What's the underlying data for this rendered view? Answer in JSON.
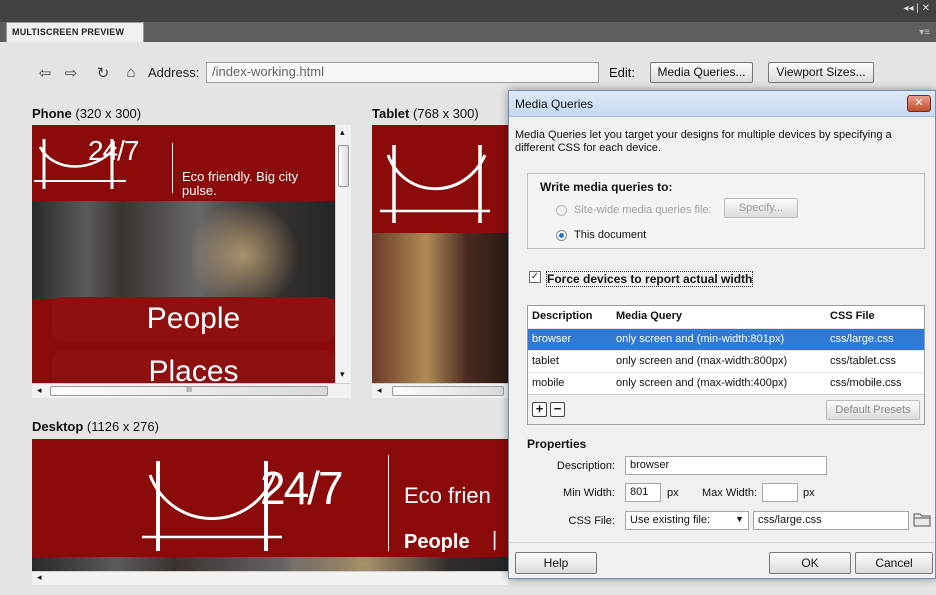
{
  "panel": {
    "tab_label": "MULTISCREEN PREVIEW",
    "window_controls": "◂◂ | ✕",
    "menu_icon": "▾≡"
  },
  "toolbar": {
    "back_icon": "back-icon",
    "forward_icon": "forward-icon",
    "refresh_icon": "refresh-icon",
    "home_icon": "home-icon",
    "address_label": "Address:",
    "address_value": "/index-working.html",
    "edit_label": "Edit:",
    "media_queries_button": "Media Queries...",
    "viewport_sizes_button": "Viewport Sizes..."
  },
  "previews": {
    "phone": {
      "name": "Phone",
      "size": "(320 x 300)"
    },
    "tablet": {
      "name": "Tablet",
      "size": "(768 x 300)"
    },
    "desktop": {
      "name": "Desktop",
      "size": "(1126 x 276)"
    }
  },
  "site": {
    "logo_text": "24/7",
    "tagline": "Eco friendly. Big city pulse.",
    "tagline_desktop": "Eco frien",
    "nav_people": "People",
    "nav_places": "Places",
    "nav_sep": "|"
  },
  "scrollbar": {
    "grip": "III",
    "left_arrow": "◂",
    "up_arrow": "▴",
    "down_arrow": "▾"
  },
  "dialog": {
    "title": "Media Queries",
    "close": "✕",
    "intro": "Media Queries let you target your designs for multiple devices by specifying a different CSS for each device.",
    "write_to_label": "Write media queries to:",
    "option_sitewide": "Site-wide media queries file:",
    "specify_button": "Specify...",
    "option_document": "This document",
    "force_label": "Force devices to report actual width",
    "table": {
      "headers": [
        "Description",
        "Media Query",
        "CSS File"
      ],
      "rows": [
        {
          "description": "browser",
          "query": "only screen and (min-width:801px)",
          "file": "css/large.css"
        },
        {
          "description": "tablet",
          "query": "only screen and (max-width:800px)",
          "file": "css/tablet.css"
        },
        {
          "description": "mobile",
          "query": "only screen and (max-width:400px)",
          "file": "css/mobile.css"
        }
      ],
      "add": "+",
      "remove": "−",
      "default_presets": "Default Presets"
    },
    "properties": {
      "heading": "Properties",
      "description_label": "Description:",
      "description_value": "browser",
      "min_width_label": "Min Width:",
      "min_width_value": "801",
      "px1": "px",
      "max_width_label": "Max Width:",
      "max_width_value": "",
      "px2": "px",
      "css_file_label": "CSS File:",
      "css_file_mode": "Use existing file:",
      "css_file_value": "css/large.css"
    },
    "help_button": "Help",
    "ok_button": "OK",
    "cancel_button": "Cancel"
  }
}
